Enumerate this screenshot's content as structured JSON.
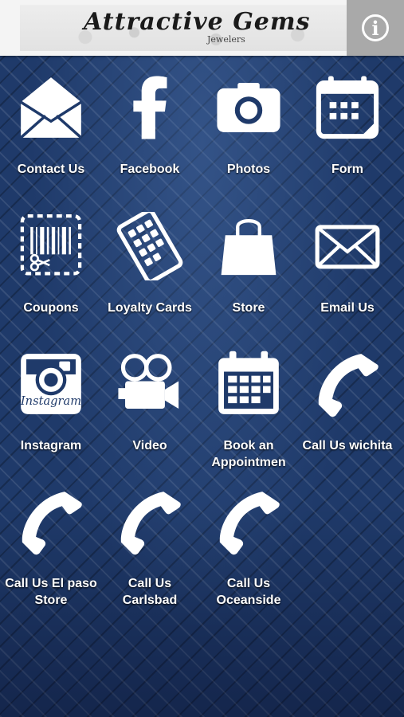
{
  "header": {
    "logo_title": "Attractive Gems",
    "logo_subtitle": "Jewelers",
    "info_label": "i"
  },
  "tiles": [
    {
      "label": "Contact Us",
      "icon": "envelope-open-icon"
    },
    {
      "label": "Facebook",
      "icon": "facebook-icon"
    },
    {
      "label": "Photos",
      "icon": "camera-icon"
    },
    {
      "label": "Form",
      "icon": "calendar-form-icon"
    },
    {
      "label": "Coupons",
      "icon": "coupon-scissors-icon"
    },
    {
      "label": "Loyalty Cards",
      "icon": "loyalty-card-icon"
    },
    {
      "label": "Store",
      "icon": "shopping-bag-icon"
    },
    {
      "label": "Email Us",
      "icon": "envelope-icon"
    },
    {
      "label": "Instagram",
      "icon": "instagram-icon"
    },
    {
      "label": "Video",
      "icon": "video-camera-icon"
    },
    {
      "label": "Book an Appointmen",
      "icon": "calendar-icon"
    },
    {
      "label": "Call Us wichita",
      "icon": "phone-icon"
    },
    {
      "label": "Call Us El paso Store",
      "icon": "phone-icon"
    },
    {
      "label": "Call Us Carlsbad",
      "icon": "phone-icon"
    },
    {
      "label": "Call Us Oceanside",
      "icon": "phone-icon"
    }
  ]
}
